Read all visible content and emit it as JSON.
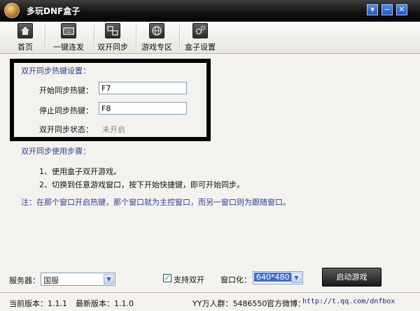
{
  "window": {
    "title": "多玩DNF盒子",
    "buttons": {
      "dropdown": "▾",
      "minimize": "−",
      "close": "✕"
    }
  },
  "toolbar": {
    "items": [
      {
        "label": "首页",
        "icon": "home-icon"
      },
      {
        "label": "一键连发",
        "icon": "keyboard-icon"
      },
      {
        "label": "双开同步",
        "icon": "dual-window-icon"
      },
      {
        "label": "游戏专区",
        "icon": "globe-icon"
      },
      {
        "label": "盒子设置",
        "icon": "gears-icon"
      }
    ]
  },
  "hotkey": {
    "title": "双开同步热键设置：",
    "start_label": "开始同步热键：",
    "start_value": "F7",
    "stop_label": "停止同步热键：",
    "stop_value": "F8",
    "status_label": "双开同步状态：",
    "status_value": "未开启"
  },
  "steps": {
    "title": "双开同步使用步骤：",
    "items": [
      "1、使用盒子双开游戏。",
      "2、切换到任意游戏窗口，按下开始快捷键，即可开始同步。"
    ],
    "note": "注：在那个窗口开启热键，那个窗口就为主控窗口，而另一窗口则为跟随窗口。"
  },
  "bottom": {
    "server_label": "服务器：",
    "server_value": "国服",
    "dual_label": "支持双开",
    "dual_checked": "✓",
    "windowed_label": "窗口化：",
    "windowed_value": "640*480",
    "launch_label": "启动游戏"
  },
  "statusbar": {
    "current_version": "当前版本：1.1.1",
    "latest_version": "最新版本：1.1.0",
    "yy_group": "YY万人群：5486550",
    "weibo_label": "官方微博：",
    "weibo_url": "http://t.qq.com/dnfbox"
  },
  "colors": {
    "accent_blue": "#2a40a0",
    "titlebar": "#121212",
    "selected_blue": "#3d6fcf"
  }
}
